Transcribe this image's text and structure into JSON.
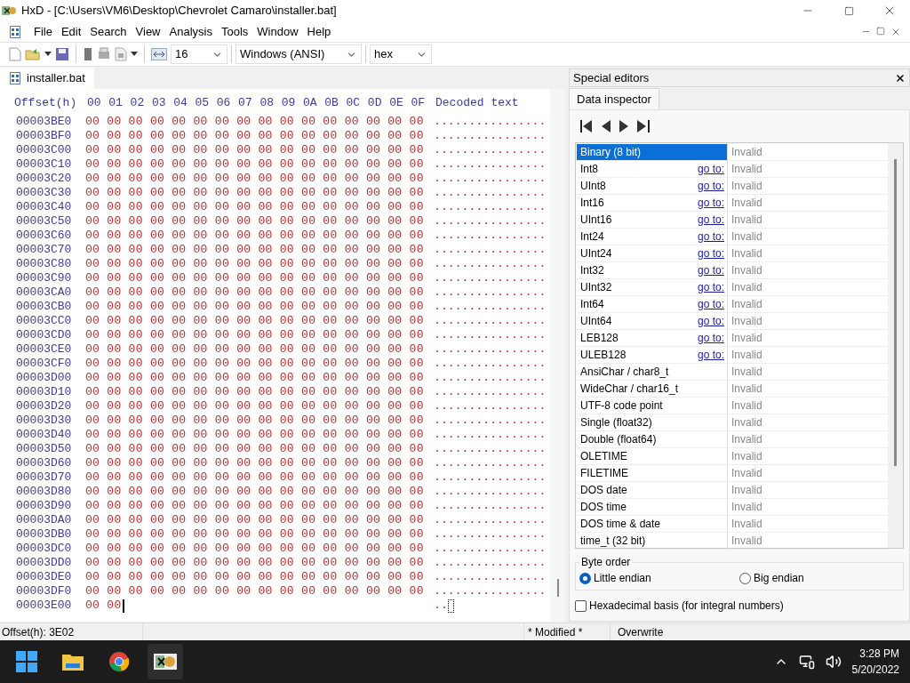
{
  "window": {
    "title": "HxD - [C:\\Users\\VM6\\Desktop\\Chevrolet Camaro\\installer.bat]"
  },
  "menu": [
    "File",
    "Edit",
    "Search",
    "View",
    "Analysis",
    "Tools",
    "Window",
    "Help"
  ],
  "toolbar": {
    "bytes_per_row": "16",
    "charset": "Windows (ANSI)",
    "base": "hex"
  },
  "file_tab": {
    "label": "installer.bat",
    "selected": true
  },
  "hex_view": {
    "offset_label": "Offset(h)",
    "columns": [
      "00",
      "01",
      "02",
      "03",
      "04",
      "05",
      "06",
      "07",
      "08",
      "09",
      "0A",
      "0B",
      "0C",
      "0D",
      "0E",
      "0F"
    ],
    "decoded_label": "Decoded text",
    "rows": [
      {
        "offset": "00003BE0",
        "bytes": "00 00 00 00 00 00 00 00 00 00 00 00 00 00 00 00",
        "decoded": "................"
      },
      {
        "offset": "00003BF0",
        "bytes": "00 00 00 00 00 00 00 00 00 00 00 00 00 00 00 00",
        "decoded": "................"
      },
      {
        "offset": "00003C00",
        "bytes": "00 00 00 00 00 00 00 00 00 00 00 00 00 00 00 00",
        "decoded": "................"
      },
      {
        "offset": "00003C10",
        "bytes": "00 00 00 00 00 00 00 00 00 00 00 00 00 00 00 00",
        "decoded": "................"
      },
      {
        "offset": "00003C20",
        "bytes": "00 00 00 00 00 00 00 00 00 00 00 00 00 00 00 00",
        "decoded": "................"
      },
      {
        "offset": "00003C30",
        "bytes": "00 00 00 00 00 00 00 00 00 00 00 00 00 00 00 00",
        "decoded": "................"
      },
      {
        "offset": "00003C40",
        "bytes": "00 00 00 00 00 00 00 00 00 00 00 00 00 00 00 00",
        "decoded": "................"
      },
      {
        "offset": "00003C50",
        "bytes": "00 00 00 00 00 00 00 00 00 00 00 00 00 00 00 00",
        "decoded": "................"
      },
      {
        "offset": "00003C60",
        "bytes": "00 00 00 00 00 00 00 00 00 00 00 00 00 00 00 00",
        "decoded": "................"
      },
      {
        "offset": "00003C70",
        "bytes": "00 00 00 00 00 00 00 00 00 00 00 00 00 00 00 00",
        "decoded": "................"
      },
      {
        "offset": "00003C80",
        "bytes": "00 00 00 00 00 00 00 00 00 00 00 00 00 00 00 00",
        "decoded": "................"
      },
      {
        "offset": "00003C90",
        "bytes": "00 00 00 00 00 00 00 00 00 00 00 00 00 00 00 00",
        "decoded": "................"
      },
      {
        "offset": "00003CA0",
        "bytes": "00 00 00 00 00 00 00 00 00 00 00 00 00 00 00 00",
        "decoded": "................"
      },
      {
        "offset": "00003CB0",
        "bytes": "00 00 00 00 00 00 00 00 00 00 00 00 00 00 00 00",
        "decoded": "................"
      },
      {
        "offset": "00003CC0",
        "bytes": "00 00 00 00 00 00 00 00 00 00 00 00 00 00 00 00",
        "decoded": "................"
      },
      {
        "offset": "00003CD0",
        "bytes": "00 00 00 00 00 00 00 00 00 00 00 00 00 00 00 00",
        "decoded": "................"
      },
      {
        "offset": "00003CE0",
        "bytes": "00 00 00 00 00 00 00 00 00 00 00 00 00 00 00 00",
        "decoded": "................"
      },
      {
        "offset": "00003CF0",
        "bytes": "00 00 00 00 00 00 00 00 00 00 00 00 00 00 00 00",
        "decoded": "................"
      },
      {
        "offset": "00003D00",
        "bytes": "00 00 00 00 00 00 00 00 00 00 00 00 00 00 00 00",
        "decoded": "................"
      },
      {
        "offset": "00003D10",
        "bytes": "00 00 00 00 00 00 00 00 00 00 00 00 00 00 00 00",
        "decoded": "................"
      },
      {
        "offset": "00003D20",
        "bytes": "00 00 00 00 00 00 00 00 00 00 00 00 00 00 00 00",
        "decoded": "................"
      },
      {
        "offset": "00003D30",
        "bytes": "00 00 00 00 00 00 00 00 00 00 00 00 00 00 00 00",
        "decoded": "................"
      },
      {
        "offset": "00003D40",
        "bytes": "00 00 00 00 00 00 00 00 00 00 00 00 00 00 00 00",
        "decoded": "................"
      },
      {
        "offset": "00003D50",
        "bytes": "00 00 00 00 00 00 00 00 00 00 00 00 00 00 00 00",
        "decoded": "................"
      },
      {
        "offset": "00003D60",
        "bytes": "00 00 00 00 00 00 00 00 00 00 00 00 00 00 00 00",
        "decoded": "................"
      },
      {
        "offset": "00003D70",
        "bytes": "00 00 00 00 00 00 00 00 00 00 00 00 00 00 00 00",
        "decoded": "................"
      },
      {
        "offset": "00003D80",
        "bytes": "00 00 00 00 00 00 00 00 00 00 00 00 00 00 00 00",
        "decoded": "................"
      },
      {
        "offset": "00003D90",
        "bytes": "00 00 00 00 00 00 00 00 00 00 00 00 00 00 00 00",
        "decoded": "................"
      },
      {
        "offset": "00003DA0",
        "bytes": "00 00 00 00 00 00 00 00 00 00 00 00 00 00 00 00",
        "decoded": "................"
      },
      {
        "offset": "00003DB0",
        "bytes": "00 00 00 00 00 00 00 00 00 00 00 00 00 00 00 00",
        "decoded": "................"
      },
      {
        "offset": "00003DC0",
        "bytes": "00 00 00 00 00 00 00 00 00 00 00 00 00 00 00 00",
        "decoded": "................"
      },
      {
        "offset": "00003DD0",
        "bytes": "00 00 00 00 00 00 00 00 00 00 00 00 00 00 00 00",
        "decoded": "................"
      },
      {
        "offset": "00003DE0",
        "bytes": "00 00 00 00 00 00 00 00 00 00 00 00 00 00 00 00",
        "decoded": "................"
      },
      {
        "offset": "00003DF0",
        "bytes": "00 00 00 00 00 00 00 00 00 00 00 00 00 00 00 00",
        "decoded": "................"
      },
      {
        "offset": "00003E00",
        "bytes": "00 00",
        "decoded": "..",
        "caret": true
      }
    ]
  },
  "side_panel": {
    "title": "Special editors",
    "tab": {
      "label": "Data inspector",
      "selected": true
    },
    "rows": [
      {
        "type": "Binary (8 bit)",
        "value": "Invalid",
        "selected": true
      },
      {
        "type": "Int8",
        "link": "go to:",
        "value": "Invalid",
        "selected": false
      },
      {
        "type": "UInt8",
        "link": "go to:",
        "value": "Invalid",
        "selected": false
      },
      {
        "type": "Int16",
        "link": "go to:",
        "value": "Invalid",
        "selected": false
      },
      {
        "type": "UInt16",
        "link": "go to:",
        "value": "Invalid",
        "selected": false
      },
      {
        "type": "Int24",
        "link": "go to:",
        "value": "Invalid",
        "selected": false
      },
      {
        "type": "UInt24",
        "link": "go to:",
        "value": "Invalid",
        "selected": false
      },
      {
        "type": "Int32",
        "link": "go to:",
        "value": "Invalid",
        "selected": false
      },
      {
        "type": "UInt32",
        "link": "go to:",
        "value": "Invalid",
        "selected": false
      },
      {
        "type": "Int64",
        "link": "go to:",
        "value": "Invalid",
        "selected": false
      },
      {
        "type": "UInt64",
        "link": "go to:",
        "value": "Invalid",
        "selected": false
      },
      {
        "type": "LEB128",
        "link": "go to:",
        "value": "Invalid",
        "selected": false
      },
      {
        "type": "ULEB128",
        "link": "go to:",
        "value": "Invalid",
        "selected": false
      },
      {
        "type": "AnsiChar / char8_t",
        "value": "Invalid",
        "selected": false
      },
      {
        "type": "WideChar / char16_t",
        "value": "Invalid",
        "selected": false
      },
      {
        "type": "UTF-8 code point",
        "value": "Invalid",
        "selected": false
      },
      {
        "type": "Single (float32)",
        "value": "Invalid",
        "selected": false
      },
      {
        "type": "Double (float64)",
        "value": "Invalid",
        "selected": false
      },
      {
        "type": "OLETIME",
        "value": "Invalid",
        "selected": false
      },
      {
        "type": "FILETIME",
        "value": "Invalid",
        "selected": false
      },
      {
        "type": "DOS date",
        "value": "Invalid",
        "selected": false
      },
      {
        "type": "DOS time",
        "value": "Invalid",
        "selected": false
      },
      {
        "type": "DOS time & date",
        "value": "Invalid",
        "selected": false
      },
      {
        "type": "time_t (32 bit)",
        "value": "Invalid",
        "selected": false
      }
    ],
    "byte_order": {
      "label": "Byte order",
      "options": [
        {
          "label": "Little endian",
          "selected": true
        },
        {
          "label": "Big endian",
          "selected": false
        }
      ]
    },
    "hex_basis": {
      "label": "Hexadecimal basis (for integral numbers)",
      "checked": false
    }
  },
  "status_bar": {
    "offset": "Offset(h): 3E02",
    "modified": "* Modified *",
    "mode": "Overwrite"
  },
  "taskbar": {
    "time": "3:28 PM",
    "date": "5/20/2022"
  }
}
